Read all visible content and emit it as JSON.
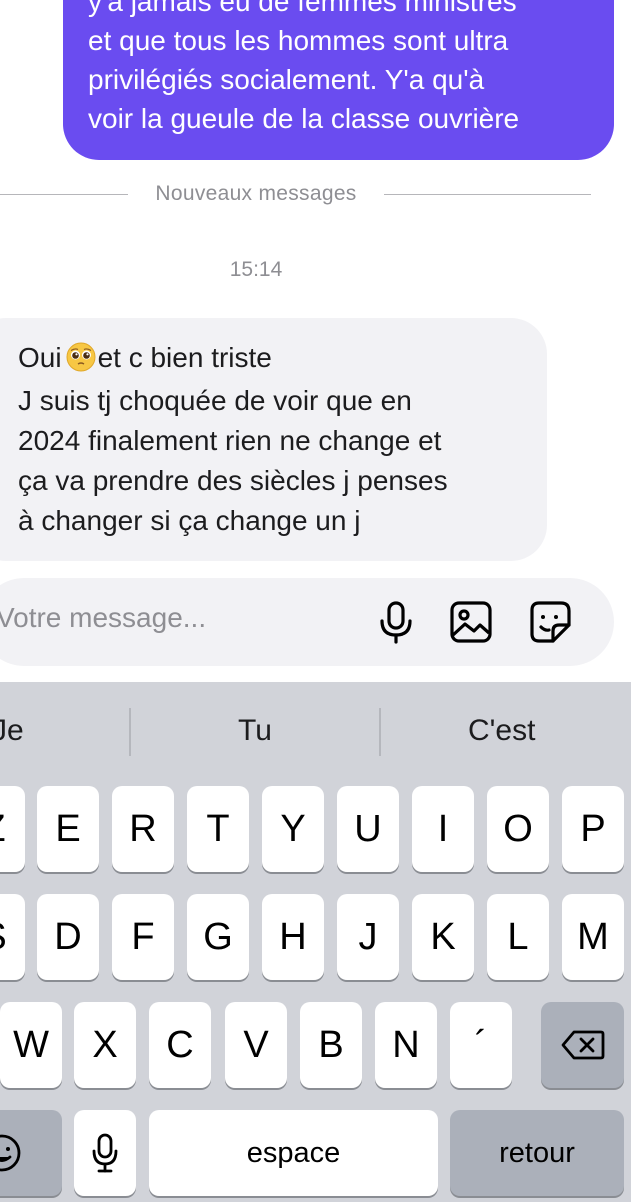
{
  "conversation": {
    "outgoing_message": {
      "lines": [
        "y'a jamais eu de femmes ministres",
        "et que tous les hommes sont ultra",
        "privilégiés socialement. Y'a qu'à",
        "voir la gueule de la classe ouvrière"
      ]
    },
    "divider_label": "Nouveaux messages",
    "timestamp": "15:14",
    "incoming_message": {
      "line1_before_emoji": "Oui",
      "line1_after_emoji": "et c bien triste",
      "emoji": "pleading-face",
      "lines": [
        "J suis tj choquée de voir que en",
        "2024 finalement rien ne change et",
        "ça va prendre des siècles j penses",
        "à changer si ça change un j"
      ]
    }
  },
  "composer": {
    "placeholder": "Votre message...",
    "icons": [
      "microphone-icon",
      "image-icon",
      "sticker-icon"
    ]
  },
  "keyboard": {
    "suggestions": [
      "Je",
      "Tu",
      "C'est"
    ],
    "row1": [
      "Z",
      "E",
      "R",
      "T",
      "Y",
      "U",
      "I",
      "O",
      "P"
    ],
    "row2": [
      "S",
      "D",
      "F",
      "G",
      "H",
      "J",
      "K",
      "L",
      "M"
    ],
    "row3": [
      "W",
      "X",
      "C",
      "V",
      "B",
      "N",
      "´"
    ],
    "space_label": "espace",
    "return_label": "retour"
  },
  "colors": {
    "outgoing_bubble": "#6a4cf0",
    "incoming_bubble": "#f2f2f5",
    "keyboard_bg": "#d1d3d9"
  }
}
